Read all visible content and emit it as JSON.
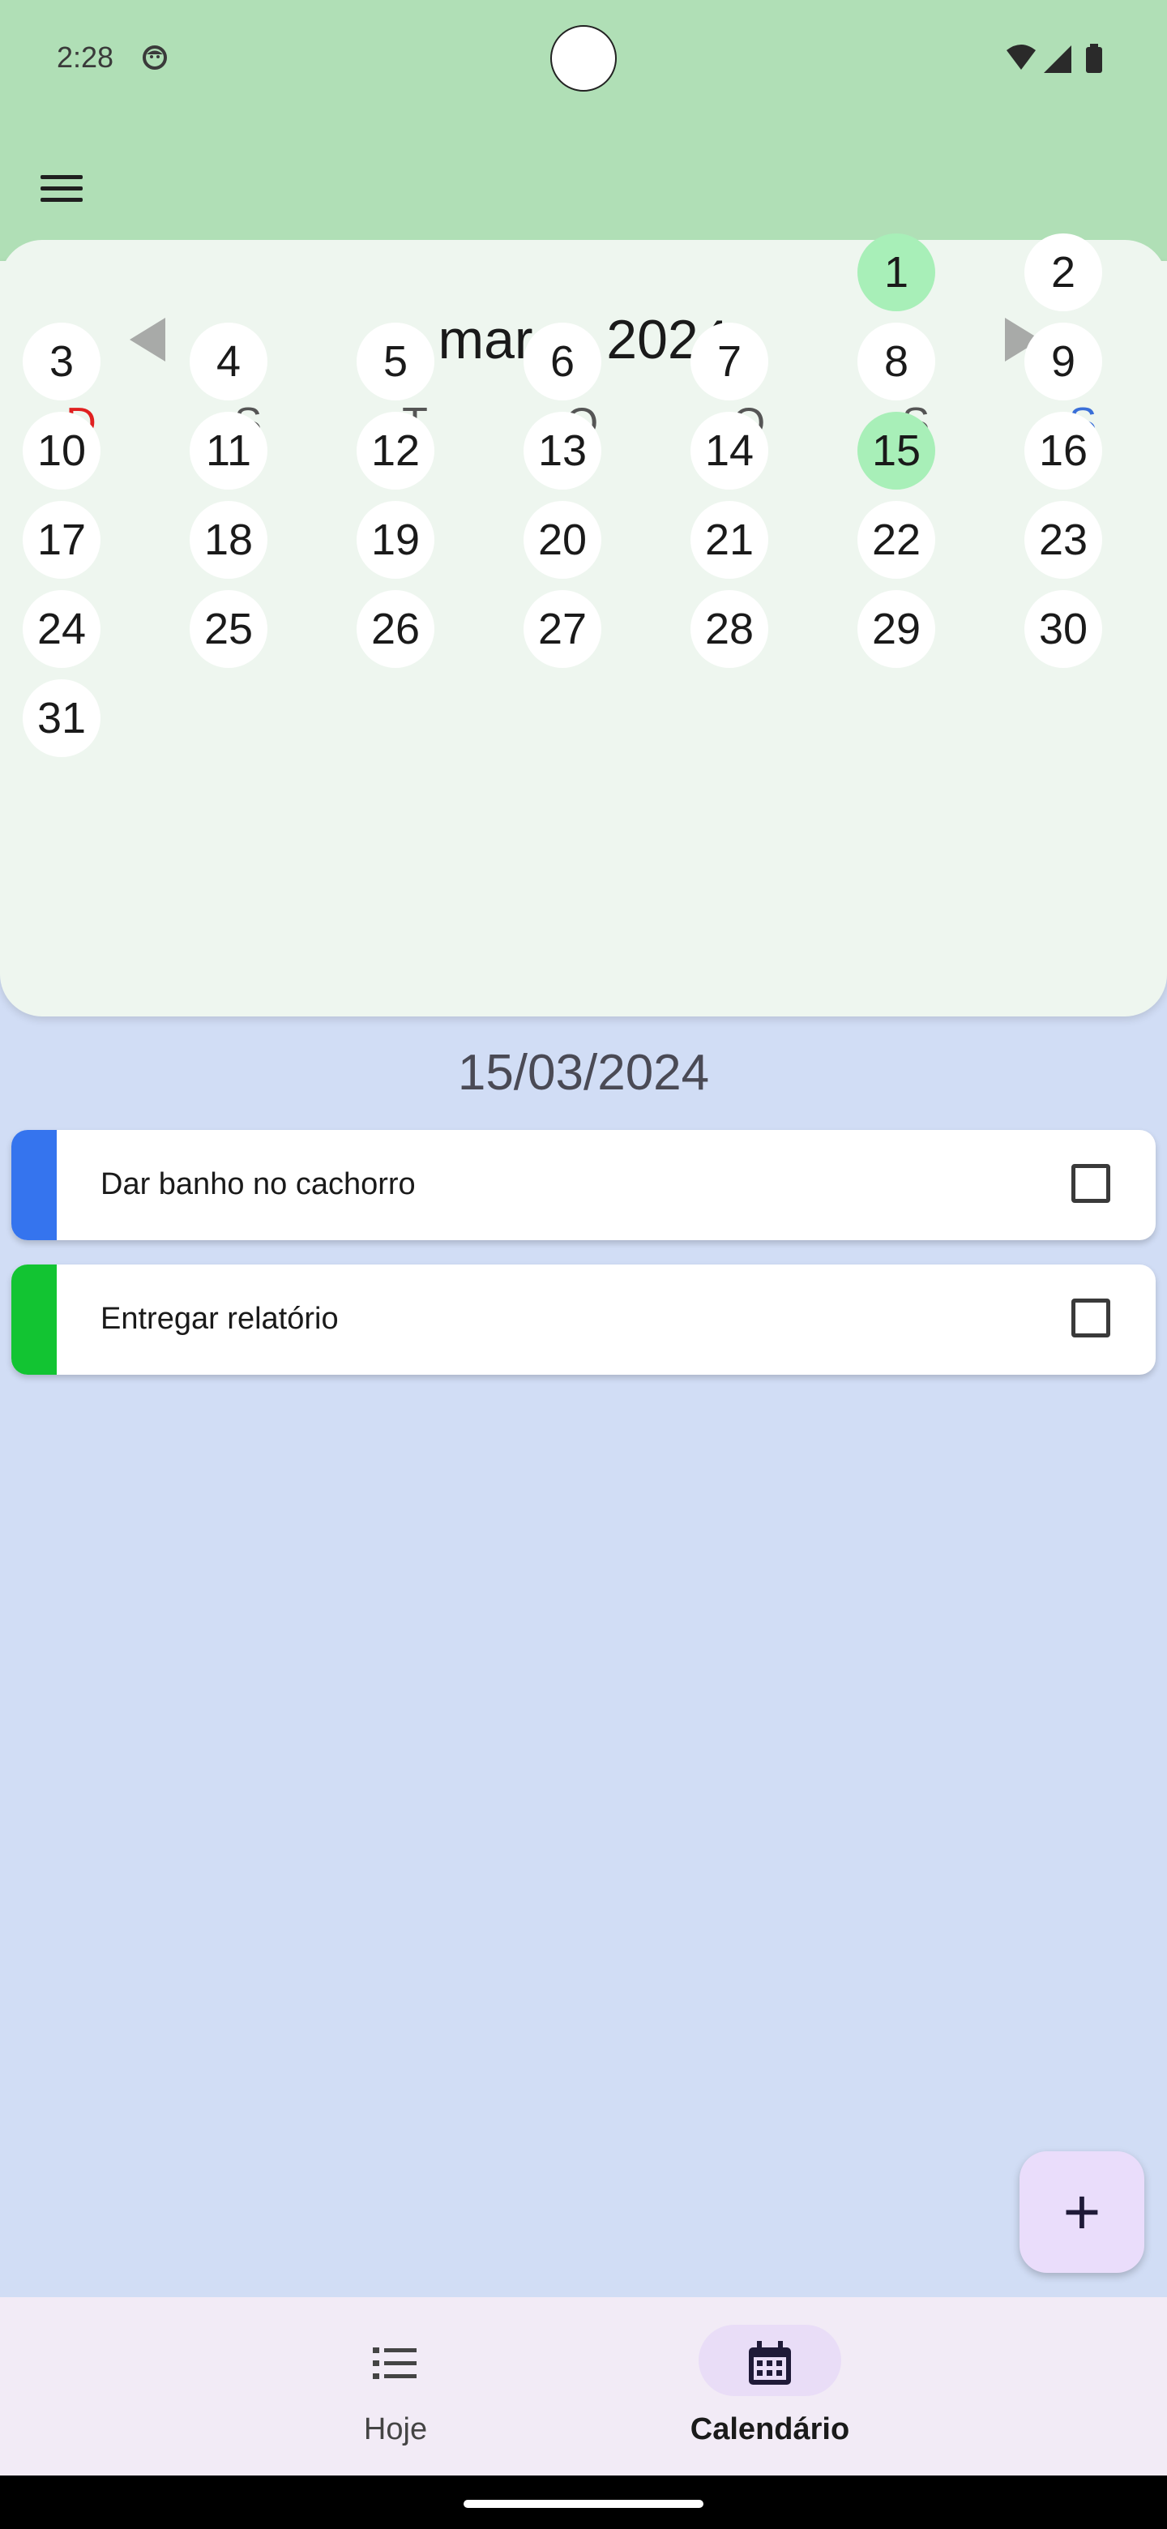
{
  "status_bar": {
    "time": "2:28"
  },
  "calendar": {
    "month_title": "março 2024",
    "weekdays": [
      "D",
      "S",
      "T",
      "Q",
      "Q",
      "S",
      "S"
    ],
    "weekday_colors": [
      "#e02020",
      "#555555",
      "#555555",
      "#555555",
      "#555555",
      "#555555",
      "#3a6fd8"
    ],
    "days": [
      "1",
      "2",
      "3",
      "4",
      "5",
      "6",
      "7",
      "8",
      "9",
      "10",
      "11",
      "12",
      "13",
      "14",
      "15",
      "16",
      "17",
      "18",
      "19",
      "20",
      "21",
      "22",
      "23",
      "24",
      "25",
      "26",
      "27",
      "28",
      "29",
      "30",
      "31"
    ],
    "highlighted_days": [
      "1",
      "15"
    ]
  },
  "selected_date": "15/03/2024",
  "tasks": [
    {
      "label": "Dar banho no cachorro",
      "color": "#3574ee",
      "checked": false
    },
    {
      "label": "Entregar relatório",
      "color": "#12c432",
      "checked": false
    }
  ],
  "fab": {
    "label": "+"
  },
  "bottom_nav": [
    {
      "label": "Hoje",
      "icon": "list-icon",
      "active": false
    },
    {
      "label": "Calendário",
      "icon": "calendar-icon",
      "active": true
    }
  ]
}
